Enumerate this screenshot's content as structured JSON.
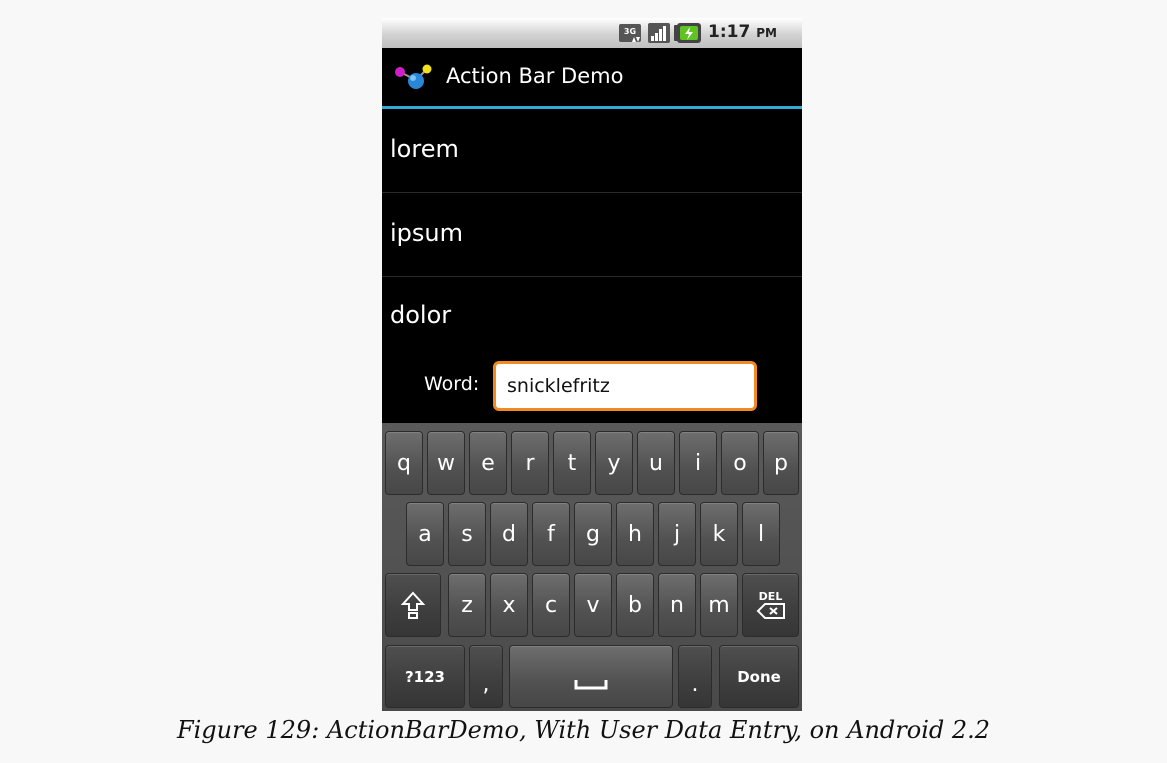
{
  "status_bar": {
    "network_icon": "3g-data-icon",
    "signal_icon": "signal-strength-icon",
    "battery_icon": "battery-charging-icon",
    "time": "1:17",
    "ampm": "PM"
  },
  "action_bar": {
    "title": "Action Bar Demo",
    "logo_icon": "molecule-app-icon",
    "accent_color": "#33a9d6"
  },
  "list": {
    "items": [
      "lorem",
      "ipsum",
      "dolor"
    ]
  },
  "word_row": {
    "label": "Word:",
    "value": "snicklefritz",
    "focus_color": "#f08a22"
  },
  "keyboard": {
    "row1": [
      "q",
      "w",
      "e",
      "r",
      "t",
      "y",
      "u",
      "i",
      "o",
      "p"
    ],
    "row2": [
      "a",
      "s",
      "d",
      "f",
      "g",
      "h",
      "j",
      "k",
      "l"
    ],
    "row3": [
      "z",
      "x",
      "c",
      "v",
      "b",
      "n",
      "m"
    ],
    "shift_icon": "shift-icon",
    "delete_label": "DEL",
    "delete_icon": "backspace-icon",
    "symbols_label": "?123",
    "comma": ",",
    "space_icon": "spacebar-icon",
    "period": ".",
    "done_label": "Done"
  },
  "caption": "Figure 129: ActionBarDemo, With User Data Entry, on Android 2.2"
}
